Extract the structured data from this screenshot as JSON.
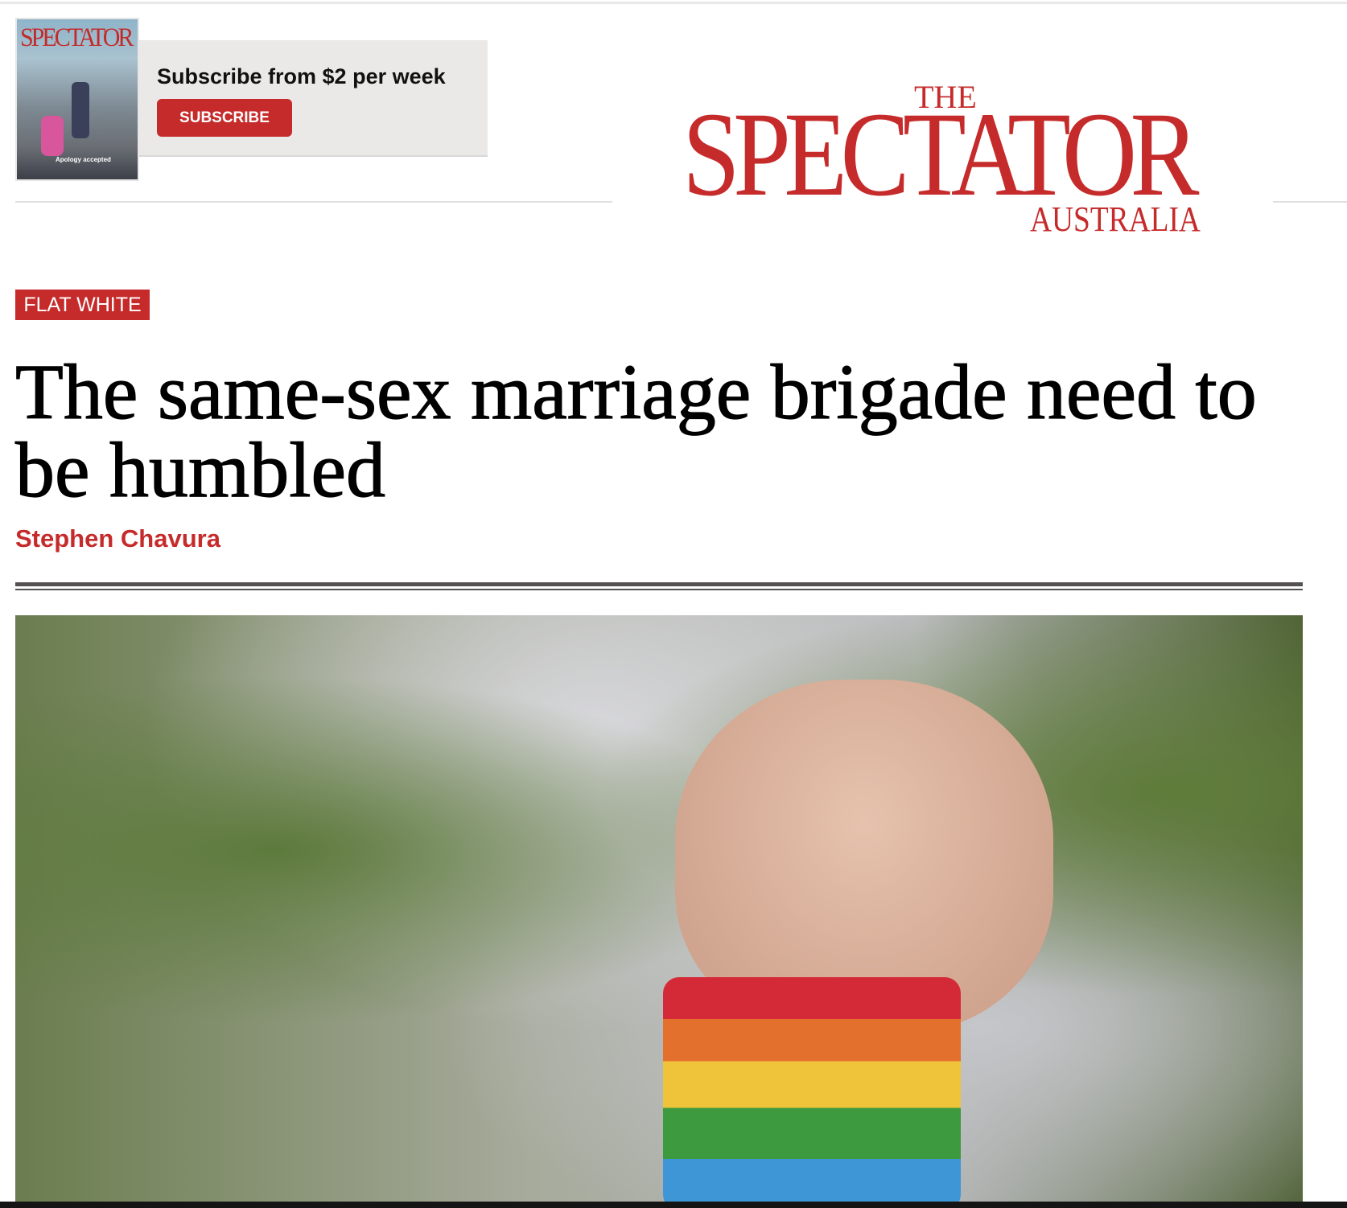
{
  "promo": {
    "cover_title": "SPECTATOR",
    "cover_caption": "Apology accepted",
    "text": "Subscribe from $2 per week",
    "button_label": "SUBSCRIBE"
  },
  "logo": {
    "the": "THE",
    "main": "SPECTATOR",
    "region": "AUSTRALIA"
  },
  "article": {
    "section": "FLAT WHITE",
    "headline": "The same-sex marriage brigade need to be humbled",
    "author": "Stephen Chavura",
    "hero_image_alt": "Raised fist wearing rainbow wristband"
  },
  "colors": {
    "brand_red": "#c62b2b",
    "rule": "#555052",
    "promo_bg": "#ebe9e7"
  }
}
